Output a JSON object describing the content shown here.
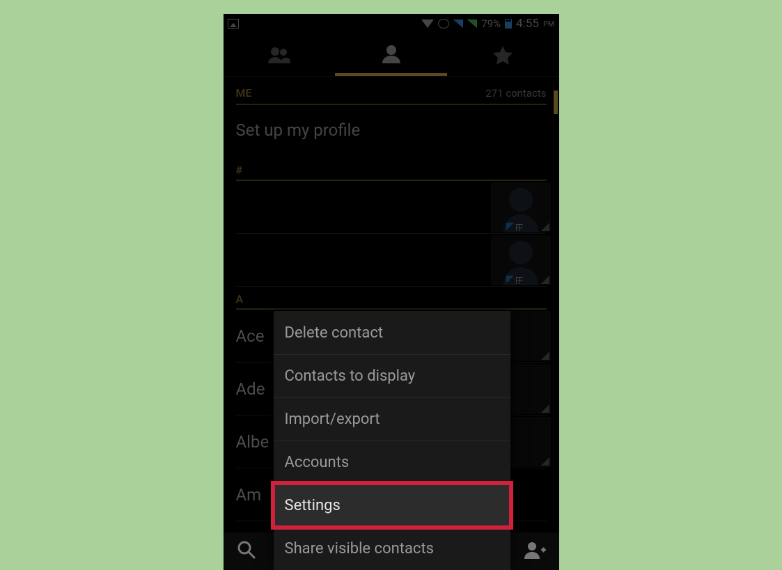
{
  "status_bar": {
    "battery_pct": "79%",
    "time": "4:55",
    "ampm": "PM"
  },
  "sections": {
    "me_label": "ME",
    "contacts_count": "271 contacts",
    "setup_profile": "Set up my profile",
    "hash_header": "#",
    "a_header": "A"
  },
  "contacts": {
    "a": [
      "Ace",
      "Ade",
      "Albe",
      "Am"
    ]
  },
  "menu": {
    "items": [
      "Delete contact",
      "Contacts to display",
      "Import/export",
      "Accounts",
      "Settings",
      "Share visible contacts"
    ],
    "highlighted_index": 4
  }
}
